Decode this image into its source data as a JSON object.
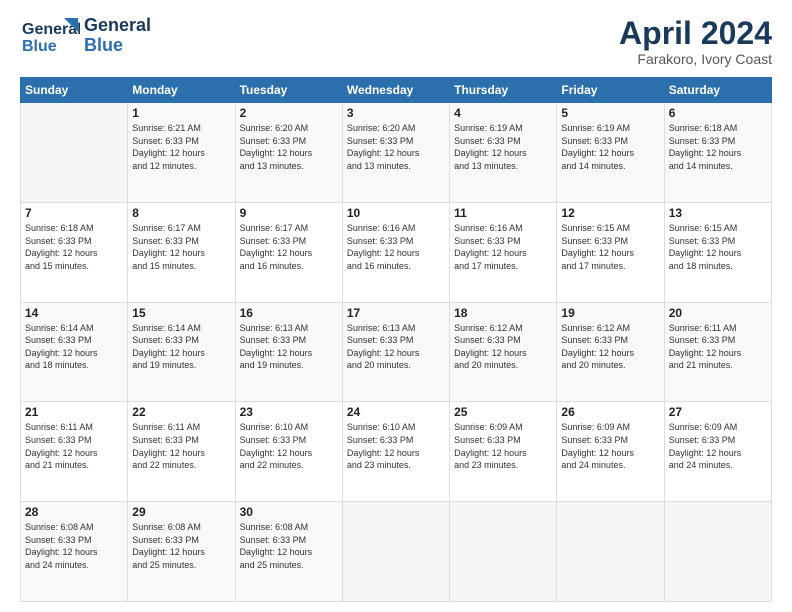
{
  "header": {
    "logo_line1": "General",
    "logo_line2": "Blue",
    "title": "April 2024",
    "subtitle": "Farakoro, Ivory Coast"
  },
  "columns": [
    "Sunday",
    "Monday",
    "Tuesday",
    "Wednesday",
    "Thursday",
    "Friday",
    "Saturday"
  ],
  "weeks": [
    [
      {
        "day": "",
        "info": ""
      },
      {
        "day": "1",
        "info": "Sunrise: 6:21 AM\nSunset: 6:33 PM\nDaylight: 12 hours\nand 12 minutes."
      },
      {
        "day": "2",
        "info": "Sunrise: 6:20 AM\nSunset: 6:33 PM\nDaylight: 12 hours\nand 13 minutes."
      },
      {
        "day": "3",
        "info": "Sunrise: 6:20 AM\nSunset: 6:33 PM\nDaylight: 12 hours\nand 13 minutes."
      },
      {
        "day": "4",
        "info": "Sunrise: 6:19 AM\nSunset: 6:33 PM\nDaylight: 12 hours\nand 13 minutes."
      },
      {
        "day": "5",
        "info": "Sunrise: 6:19 AM\nSunset: 6:33 PM\nDaylight: 12 hours\nand 14 minutes."
      },
      {
        "day": "6",
        "info": "Sunrise: 6:18 AM\nSunset: 6:33 PM\nDaylight: 12 hours\nand 14 minutes."
      }
    ],
    [
      {
        "day": "7",
        "info": "Sunrise: 6:18 AM\nSunset: 6:33 PM\nDaylight: 12 hours\nand 15 minutes."
      },
      {
        "day": "8",
        "info": "Sunrise: 6:17 AM\nSunset: 6:33 PM\nDaylight: 12 hours\nand 15 minutes."
      },
      {
        "day": "9",
        "info": "Sunrise: 6:17 AM\nSunset: 6:33 PM\nDaylight: 12 hours\nand 16 minutes."
      },
      {
        "day": "10",
        "info": "Sunrise: 6:16 AM\nSunset: 6:33 PM\nDaylight: 12 hours\nand 16 minutes."
      },
      {
        "day": "11",
        "info": "Sunrise: 6:16 AM\nSunset: 6:33 PM\nDaylight: 12 hours\nand 17 minutes."
      },
      {
        "day": "12",
        "info": "Sunrise: 6:15 AM\nSunset: 6:33 PM\nDaylight: 12 hours\nand 17 minutes."
      },
      {
        "day": "13",
        "info": "Sunrise: 6:15 AM\nSunset: 6:33 PM\nDaylight: 12 hours\nand 18 minutes."
      }
    ],
    [
      {
        "day": "14",
        "info": "Sunrise: 6:14 AM\nSunset: 6:33 PM\nDaylight: 12 hours\nand 18 minutes."
      },
      {
        "day": "15",
        "info": "Sunrise: 6:14 AM\nSunset: 6:33 PM\nDaylight: 12 hours\nand 19 minutes."
      },
      {
        "day": "16",
        "info": "Sunrise: 6:13 AM\nSunset: 6:33 PM\nDaylight: 12 hours\nand 19 minutes."
      },
      {
        "day": "17",
        "info": "Sunrise: 6:13 AM\nSunset: 6:33 PM\nDaylight: 12 hours\nand 20 minutes."
      },
      {
        "day": "18",
        "info": "Sunrise: 6:12 AM\nSunset: 6:33 PM\nDaylight: 12 hours\nand 20 minutes."
      },
      {
        "day": "19",
        "info": "Sunrise: 6:12 AM\nSunset: 6:33 PM\nDaylight: 12 hours\nand 20 minutes."
      },
      {
        "day": "20",
        "info": "Sunrise: 6:11 AM\nSunset: 6:33 PM\nDaylight: 12 hours\nand 21 minutes."
      }
    ],
    [
      {
        "day": "21",
        "info": "Sunrise: 6:11 AM\nSunset: 6:33 PM\nDaylight: 12 hours\nand 21 minutes."
      },
      {
        "day": "22",
        "info": "Sunrise: 6:11 AM\nSunset: 6:33 PM\nDaylight: 12 hours\nand 22 minutes."
      },
      {
        "day": "23",
        "info": "Sunrise: 6:10 AM\nSunset: 6:33 PM\nDaylight: 12 hours\nand 22 minutes."
      },
      {
        "day": "24",
        "info": "Sunrise: 6:10 AM\nSunset: 6:33 PM\nDaylight: 12 hours\nand 23 minutes."
      },
      {
        "day": "25",
        "info": "Sunrise: 6:09 AM\nSunset: 6:33 PM\nDaylight: 12 hours\nand 23 minutes."
      },
      {
        "day": "26",
        "info": "Sunrise: 6:09 AM\nSunset: 6:33 PM\nDaylight: 12 hours\nand 24 minutes."
      },
      {
        "day": "27",
        "info": "Sunrise: 6:09 AM\nSunset: 6:33 PM\nDaylight: 12 hours\nand 24 minutes."
      }
    ],
    [
      {
        "day": "28",
        "info": "Sunrise: 6:08 AM\nSunset: 6:33 PM\nDaylight: 12 hours\nand 24 minutes."
      },
      {
        "day": "29",
        "info": "Sunrise: 6:08 AM\nSunset: 6:33 PM\nDaylight: 12 hours\nand 25 minutes."
      },
      {
        "day": "30",
        "info": "Sunrise: 6:08 AM\nSunset: 6:33 PM\nDaylight: 12 hours\nand 25 minutes."
      },
      {
        "day": "",
        "info": ""
      },
      {
        "day": "",
        "info": ""
      },
      {
        "day": "",
        "info": ""
      },
      {
        "day": "",
        "info": ""
      }
    ]
  ]
}
